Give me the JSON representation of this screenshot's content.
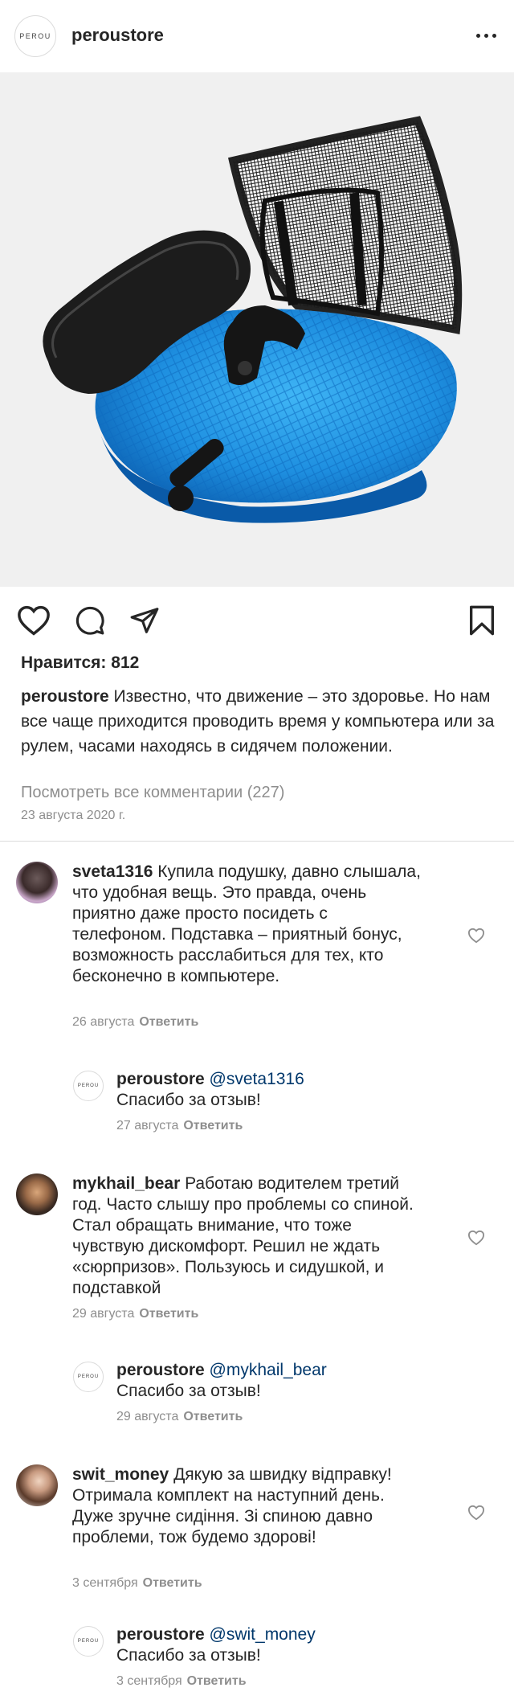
{
  "header": {
    "logo_text": "PEROU",
    "username": "peroustore",
    "more_icon": "more-horizontal-icon"
  },
  "post": {
    "image_icon": "product-photo",
    "likes_text": "Нравится: 812",
    "caption_user": "peroustore",
    "caption_text": "Известно, что движение – это здоровье. Но нам все чаще приходится проводить время у компьютера или за рулем, часами находясь в сидячем положении.",
    "view_all": "Посмотреть все комментарии (227)",
    "date": "23 августа 2020 г."
  },
  "comments": [
    {
      "user": "sveta1316",
      "text": "Купила подушку, давно слышала, что удобная вещь. Это правда, очень приятно даже просто посидеть с телефоном. Подставка – приятный бонус, возможность расслабиться для тех, кто бесконечно в компьютере.",
      "date": "26 августа",
      "reply": "Ответить",
      "reply_user": "peroustore",
      "reply_logo": "PEROU",
      "reply_mention": "@sveta1316",
      "reply_text": "Спасибо за отзыв!",
      "reply_date": "27 августа",
      "reply_reply": "Ответить"
    },
    {
      "user": "mykhail_bear",
      "text": "Работаю водителем третий год. Часто слышу про проблемы со спиной. Стал обращать внимание, что тоже чувствую дискомфорт. Решил не ждать «сюрпризов». Пользуюсь и сидушкой, и подставкой",
      "date": "29 августа",
      "reply": "Ответить",
      "reply_user": "peroustore",
      "reply_logo": "PEROU",
      "reply_mention": "@mykhail_bear",
      "reply_text": "Спасибо за отзыв!",
      "reply_date": "29 августа",
      "reply_reply": "Ответить"
    },
    {
      "user": "swit_money",
      "text": "Дякую за швидку відправку! Отримала комплект на наступний день. Дуже зручне сидіння. Зі спиною давно проблеми, тож будемо здорові!",
      "date": "3 сентября",
      "reply": "Ответить",
      "reply_user": "peroustore",
      "reply_logo": "PEROU",
      "reply_mention": "@swit_money",
      "reply_text": "Спасибо за отзыв!",
      "reply_date": "3 сентября",
      "reply_reply": "Ответить"
    }
  ],
  "colors": {
    "text": "#262626",
    "muted": "#8e8e8e",
    "mention": "#00376b",
    "cushion_blue": "#1e8fe0"
  }
}
